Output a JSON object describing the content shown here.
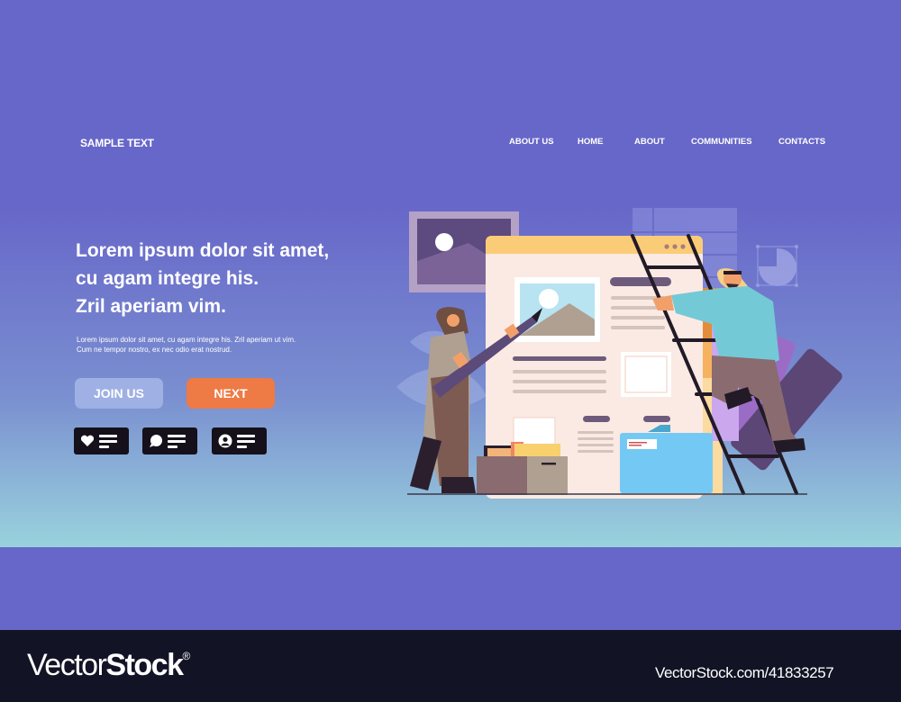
{
  "header": {
    "brand": "SAMPLE TEXT",
    "nav": [
      {
        "label": "ABOUT US"
      },
      {
        "label": "HOME"
      },
      {
        "label": "ABOUT"
      },
      {
        "label": "COMMUNITIES"
      },
      {
        "label": "CONTACTS"
      }
    ]
  },
  "hero": {
    "headline_lines": [
      "Lorem ipsum dolor sit amet,",
      "cu agam integre his.",
      "Zril aperiam vim."
    ],
    "body_lines": [
      "Lorem ipsum dolor sit amet, cu agam integre his.  Zril aperiam ut vim.",
      "Cum ne tempor nostro,  ex nec odio erat nostrud."
    ],
    "buttons": {
      "join": "JOIN US",
      "next": "NEXT"
    },
    "chips": [
      {
        "icon": "heart-icon"
      },
      {
        "icon": "chat-bubble-icon"
      },
      {
        "icon": "user-avatar-icon"
      }
    ]
  },
  "colors": {
    "primary_purple": "#6767c9",
    "gradient_bottom": "#99d2dd",
    "next_orange": "#ee7a45",
    "join_blue": "#9fb0e4",
    "chip_dark": "#151019",
    "footer_dark": "#121324"
  },
  "illustration": {
    "description": "Two people building a web page layout: woman with oversized pencil, man climbing a ladder beside browser window mockup",
    "elements": [
      "image-frame",
      "browser-window",
      "ladder",
      "pencil",
      "file-box",
      "folder",
      "table-grid",
      "pie-chart-widget",
      "color-palette"
    ]
  },
  "footer": {
    "logo_light": "Vector",
    "logo_bold": "Stock",
    "logo_mark": "®",
    "url": "VectorStock.com/41833257"
  }
}
